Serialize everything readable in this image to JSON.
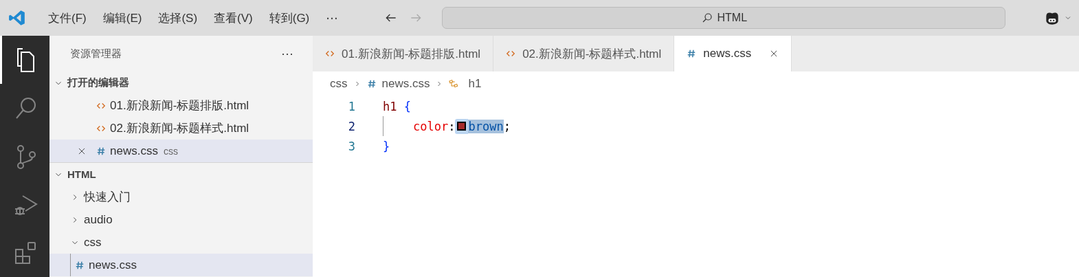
{
  "menu": [
    "文件(F)",
    "编辑(E)",
    "选择(S)",
    "查看(V)",
    "转到(G)",
    "⋯"
  ],
  "command_center": {
    "text": "HTML"
  },
  "activity_bar": [
    {
      "kind": "explorer",
      "selected": true
    },
    {
      "kind": "search",
      "selected": false
    },
    {
      "kind": "source-control",
      "selected": false
    },
    {
      "kind": "debug",
      "selected": false
    },
    {
      "kind": "extensions",
      "selected": false
    }
  ],
  "sidebar": {
    "title": "资源管理器",
    "more": "⋯",
    "open_editors": {
      "title": "打开的编辑器",
      "expanded": true,
      "items": [
        {
          "label": "01.新浪新闻-标题排版.html",
          "kind": "html",
          "selected": false
        },
        {
          "label": "02.新浪新闻-标题样式.html",
          "kind": "html",
          "selected": false
        },
        {
          "label": "news.css",
          "kind": "css",
          "description": "css",
          "selected": true
        }
      ]
    },
    "tree": {
      "label": "HTML",
      "expanded": true,
      "children": [
        {
          "label": "快速入门",
          "kind": "folder",
          "expanded": false
        },
        {
          "label": "audio",
          "kind": "folder",
          "expanded": false
        },
        {
          "label": "css",
          "kind": "folder",
          "expanded": true,
          "children": [
            {
              "label": "news.css",
              "kind": "css",
              "selected": true
            }
          ]
        }
      ]
    }
  },
  "tabs": [
    {
      "label": "01.新浪新闻-标题排版.html",
      "kind": "html",
      "selected": false
    },
    {
      "label": "02.新浪新闻-标题样式.html",
      "kind": "html",
      "selected": false
    },
    {
      "label": "news.css",
      "kind": "css",
      "selected": true
    }
  ],
  "breadcrumb": [
    {
      "label": "css",
      "kind": "folder"
    },
    {
      "label": "news.css",
      "kind": "css"
    },
    {
      "label": "h1",
      "kind": "symbol"
    }
  ],
  "code": [
    {
      "number": "1",
      "tokens": [
        {
          "text": "h1 ",
          "kind": "selector"
        },
        {
          "text": "{",
          "kind": "brace"
        }
      ]
    },
    {
      "number": "2",
      "tokens": [
        {
          "text": "color",
          "kind": "property"
        },
        {
          "text": ":",
          "kind": "punct"
        },
        {
          "kind": "swatch",
          "color": "#a52a2a"
        },
        {
          "text": "brown",
          "kind": "value",
          "highlighted": true
        },
        {
          "text": ";",
          "kind": "punct"
        }
      ]
    },
    {
      "number": "3",
      "tokens": [
        {
          "text": "}",
          "kind": "brace"
        }
      ]
    }
  ]
}
